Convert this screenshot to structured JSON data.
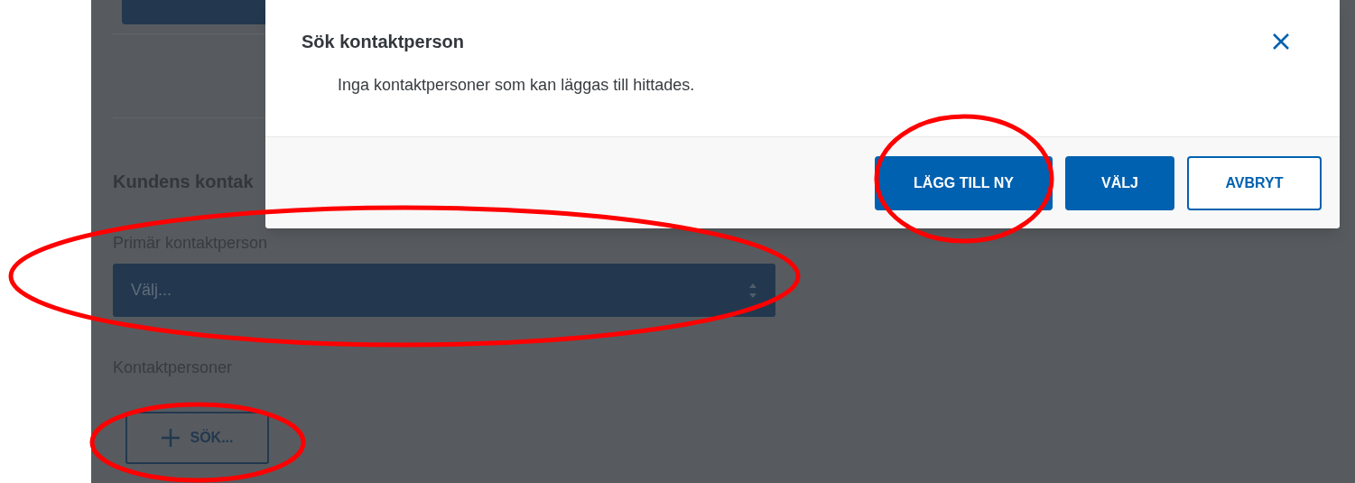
{
  "form": {
    "heading": "Kundens kontak",
    "primary_contact": {
      "label": "Primär kontaktperson",
      "placeholder": "Välj..."
    },
    "contacts": {
      "label": "Kontaktpersoner",
      "search_button": "SÖK..."
    }
  },
  "modal": {
    "title": "Sök kontaktperson",
    "message": "Inga kontaktpersoner som kan läggas till hittades.",
    "buttons": [
      {
        "label": "LÄGG TILL NY",
        "kind": "primary"
      },
      {
        "label": "VÄLJ",
        "kind": "primary"
      },
      {
        "label": "AVBRYT",
        "kind": "outline"
      }
    ]
  }
}
